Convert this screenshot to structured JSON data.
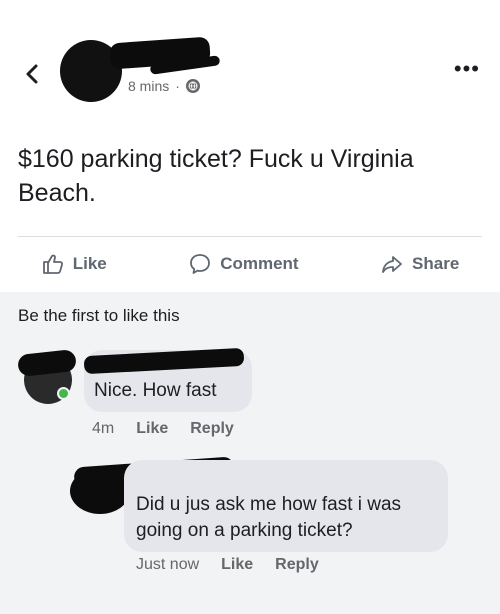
{
  "post": {
    "timestamp": "8 mins",
    "separator": "·",
    "text": "$160 parking ticket? Fuck u Virginia Beach."
  },
  "actions": {
    "like": "Like",
    "comment": "Comment",
    "share": "Share"
  },
  "likes_summary": "Be the first to like this",
  "comments": [
    {
      "text": "Nice. How fast",
      "time": "4m",
      "like": "Like",
      "reply": "Reply"
    },
    {
      "text": "Did u jus ask me how fast i was going on a parking ticket?",
      "time": "Just now",
      "like": "Like",
      "reply": "Reply"
    }
  ],
  "icons": {
    "back": "chevron-left-icon",
    "more": "more-dots-icon",
    "privacy": "globe-icon",
    "like": "thumbs-up-icon",
    "comment": "speech-bubble-icon",
    "share": "share-arrow-icon"
  },
  "colors": {
    "online": "#44b74b",
    "bubble": "#e4e6eb",
    "muted": "#65676b"
  }
}
